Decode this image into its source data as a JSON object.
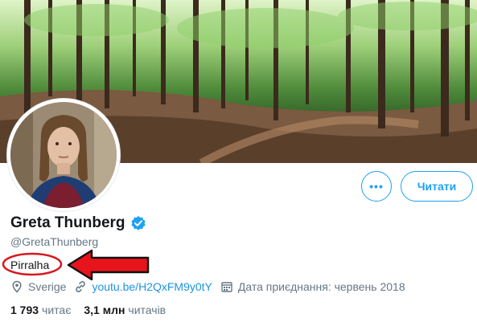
{
  "profile": {
    "name": "Greta Thunberg",
    "handle": "@GretaThunberg",
    "bio": "Pirralha",
    "location": "Sverige",
    "website": "youtu.be/H2QxFM9y0tY",
    "joined": "Дата приєднання: червень 2018"
  },
  "buttons": {
    "more_label": "•••",
    "follow_label": "Читати"
  },
  "stats": {
    "following_count": "1 793",
    "following_label": "читає",
    "followers_count": "3,1 млн",
    "followers_label": "читачів"
  },
  "icons": {
    "verified": "verified-badge-icon",
    "location": "location-pin-icon",
    "link": "link-icon",
    "calendar": "calendar-icon"
  },
  "colors": {
    "accent": "#1da1f2",
    "link": "#1b95e0",
    "annotation": "#d8181e"
  }
}
